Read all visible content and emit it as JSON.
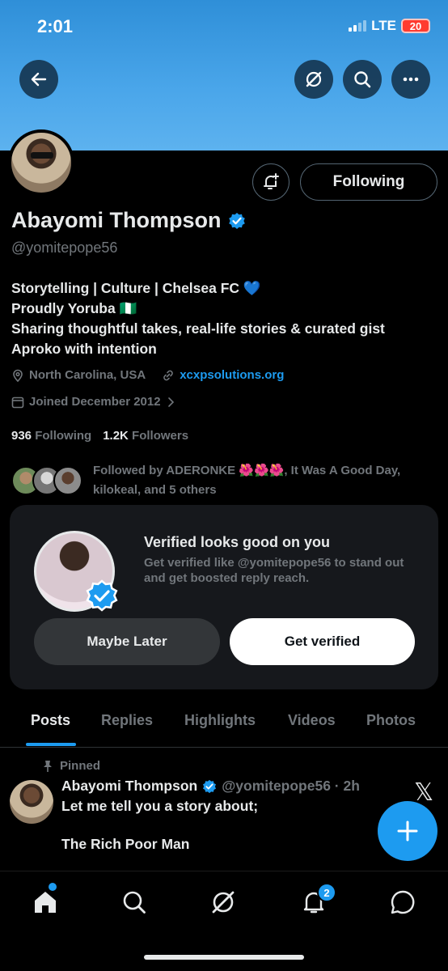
{
  "status_bar": {
    "time": "2:01",
    "network": "LTE",
    "battery": "20"
  },
  "header": {
    "back_icon": "arrow-left-icon",
    "grok_icon": "grok-icon",
    "search_icon": "search-icon",
    "more_icon": "more-horizontal-icon"
  },
  "profile": {
    "name": "Abayomi Thompson",
    "handle": "@yomitepope56",
    "following_button": "Following",
    "bio": [
      "Storytelling | Culture | Chelsea FC 💙",
      "Proudly Yoruba 🇳🇬",
      "Sharing thoughtful takes, real-life stories & curated gist",
      "Aproko with intention"
    ],
    "location": "North Carolina, USA",
    "website": "xcxpsolutions.org",
    "joined": "Joined December 2012",
    "following_count": "936",
    "following_label": "Following",
    "followers_count": "1.2K",
    "followers_label": "Followers",
    "followed_by_line1": "Followed by ADERONKE 🌺🌺🌺, It Was A Good Day,",
    "followed_by_line2": "kilokeal, and 5 others"
  },
  "verify_card": {
    "title": "Verified looks good on you",
    "description": "Get verified like @yomitepope56 to stand out and get boosted reply reach.",
    "maybe_later": "Maybe Later",
    "get_verified": "Get verified"
  },
  "tabs": [
    "Posts",
    "Replies",
    "Highlights",
    "Videos",
    "Photos"
  ],
  "post": {
    "pinned_label": "Pinned",
    "author": "Abayomi Thompson",
    "handle_time": "@yomitepope56 · 2h",
    "line1": "Let me tell you a story about;",
    "line2": "The Rich Poor Man"
  },
  "bottom_nav": {
    "notification_count": "2"
  },
  "colors": {
    "accent": "#1d9bf0",
    "banner": "#4aa6ea",
    "card": "#16181c",
    "muted": "#71767b"
  }
}
